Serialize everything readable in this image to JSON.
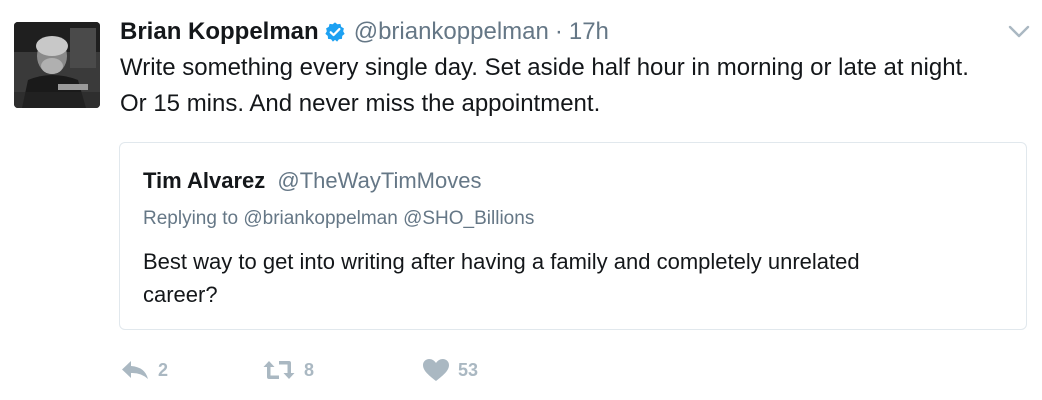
{
  "tweet": {
    "author_name": "Brian Koppelman",
    "author_handle": "@briankoppelman",
    "separator": "·",
    "timestamp": "17h",
    "verified_icon": "verified-badge-icon",
    "caret_icon": "chevron-down-icon",
    "text_lines": [
      "Write something every single day. Set aside half hour in morning or late at night.",
      "Or 15 mins. And never miss the appointment."
    ]
  },
  "quoted_tweet": {
    "author_name": "Tim Alvarez",
    "author_handle": "@TheWayTimMoves",
    "replying_to": "Replying to @briankoppelman @SHO_Billions",
    "text_lines": [
      "Best way to get into writing after having a family and completely unrelated",
      "career?"
    ]
  },
  "actions": {
    "reply": {
      "icon": "reply-icon",
      "count": "2"
    },
    "retweet": {
      "icon": "retweet-icon",
      "count": "8"
    },
    "like": {
      "icon": "heart-icon",
      "count": "53"
    }
  },
  "colors": {
    "text": "#14171a",
    "secondary": "#657786",
    "verified": "#1da1f2",
    "action_gray": "#aab8c2",
    "border": "#e1e8ed"
  }
}
